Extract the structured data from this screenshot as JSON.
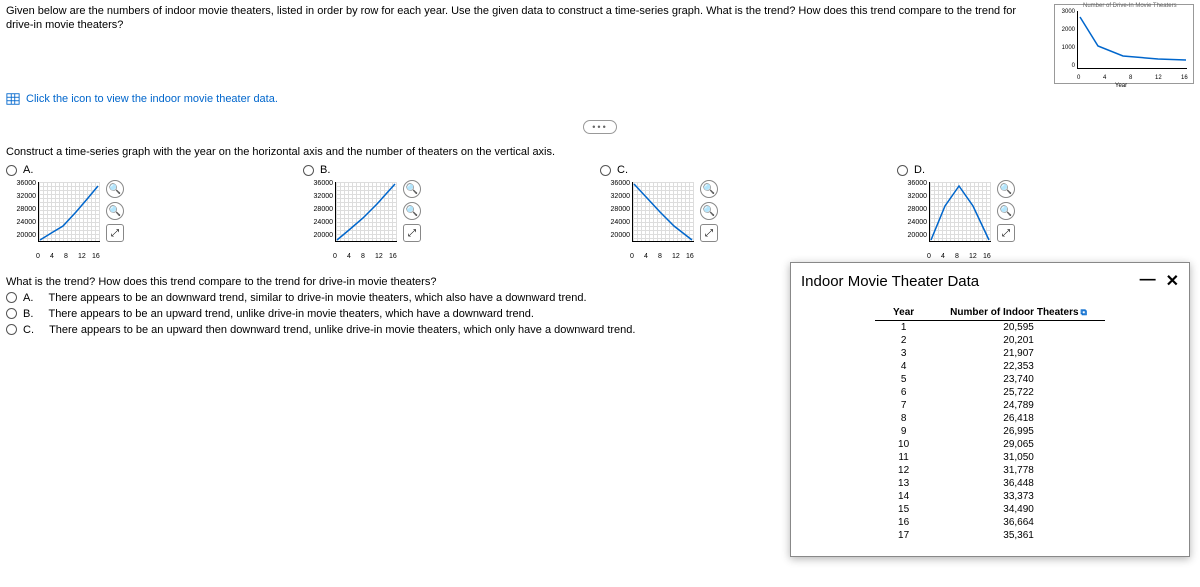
{
  "question": {
    "intro": "Given below are the numbers of indoor movie theaters, listed in order by row for each year. Use the given data to construct a time-series graph. What is the trend? How does this trend compare to the trend for drive-in movie theaters?",
    "data_link": "Click the icon to view the indoor movie theater data.",
    "construct": "Construct a time-series graph with the year on the horizontal axis and the number of theaters on the vertical axis.",
    "opt_labels": {
      "a": "A.",
      "b": "B.",
      "c": "C.",
      "d": "D."
    },
    "trend_q": "What is the trend? How does this trend compare to the trend for drive-in movie theaters?",
    "answers": {
      "a_pref": "A.",
      "a": "There appears to be an downward trend, similar to drive-in movie theaters, which also have a downward trend.",
      "b_pref": "B.",
      "b": "There appears to be an upward trend, unlike drive-in movie theaters, which have a downward trend.",
      "c_pref": "C.",
      "c": "There appears to be an upward then downward trend, unlike drive-in movie theaters, which only have a downward trend."
    }
  },
  "mini_axis": {
    "y": [
      "36000",
      "32000",
      "28000",
      "24000",
      "20000"
    ],
    "x": [
      "0",
      "4",
      "8",
      "12",
      "16"
    ]
  },
  "top_right_chart": {
    "title": "Number of Drive-In Movie Theaters",
    "y": [
      "3000",
      "2000",
      "1000",
      "0"
    ],
    "x": [
      "0",
      "4",
      "8",
      "12",
      "16"
    ],
    "xtitle": "Year"
  },
  "popup": {
    "title": "Indoor Movie Theater Data",
    "col_year": "Year",
    "col_n": "Number of Indoor Theaters",
    "rows": [
      {
        "y": "1",
        "n": "20,595"
      },
      {
        "y": "2",
        "n": "20,201"
      },
      {
        "y": "3",
        "n": "21,907"
      },
      {
        "y": "4",
        "n": "22,353"
      },
      {
        "y": "5",
        "n": "23,740"
      },
      {
        "y": "6",
        "n": "25,722"
      },
      {
        "y": "7",
        "n": "24,789"
      },
      {
        "y": "8",
        "n": "26,418"
      },
      {
        "y": "9",
        "n": "26,995"
      },
      {
        "y": "10",
        "n": "29,065"
      },
      {
        "y": "11",
        "n": "31,050"
      },
      {
        "y": "12",
        "n": "31,778"
      },
      {
        "y": "13",
        "n": "36,448"
      },
      {
        "y": "14",
        "n": "33,373"
      },
      {
        "y": "15",
        "n": "34,490"
      },
      {
        "y": "16",
        "n": "36,664"
      },
      {
        "y": "17",
        "n": "35,361"
      }
    ]
  },
  "chart_data": [
    {
      "type": "line",
      "name": "drive-in-trend",
      "title": "Number of Drive-In Movie Theaters",
      "xlabel": "Year",
      "x": [
        0,
        4,
        8,
        12,
        16
      ],
      "ylim": [
        0,
        3000
      ],
      "values": [
        2600,
        1300,
        900,
        800,
        780
      ]
    },
    {
      "type": "line",
      "name": "option-A-upward",
      "x": [
        0,
        4,
        8,
        12,
        16
      ],
      "ylim": [
        20000,
        36000
      ],
      "values": [
        20000,
        22500,
        26000,
        31000,
        36000
      ]
    },
    {
      "type": "line",
      "name": "option-B-upward-smooth",
      "x": [
        0,
        4,
        8,
        12,
        16
      ],
      "ylim": [
        20000,
        36000
      ],
      "values": [
        20000,
        23000,
        26500,
        31500,
        36000
      ]
    },
    {
      "type": "line",
      "name": "option-C-downward",
      "x": [
        0,
        4,
        8,
        12,
        16
      ],
      "ylim": [
        20000,
        36000
      ],
      "values": [
        36000,
        31000,
        26500,
        22500,
        20000
      ]
    },
    {
      "type": "line",
      "name": "option-D-up-then-down",
      "x": [
        0,
        4,
        8,
        12,
        16
      ],
      "ylim": [
        20000,
        36000
      ],
      "values": [
        20000,
        30000,
        36000,
        30000,
        20000
      ]
    }
  ]
}
